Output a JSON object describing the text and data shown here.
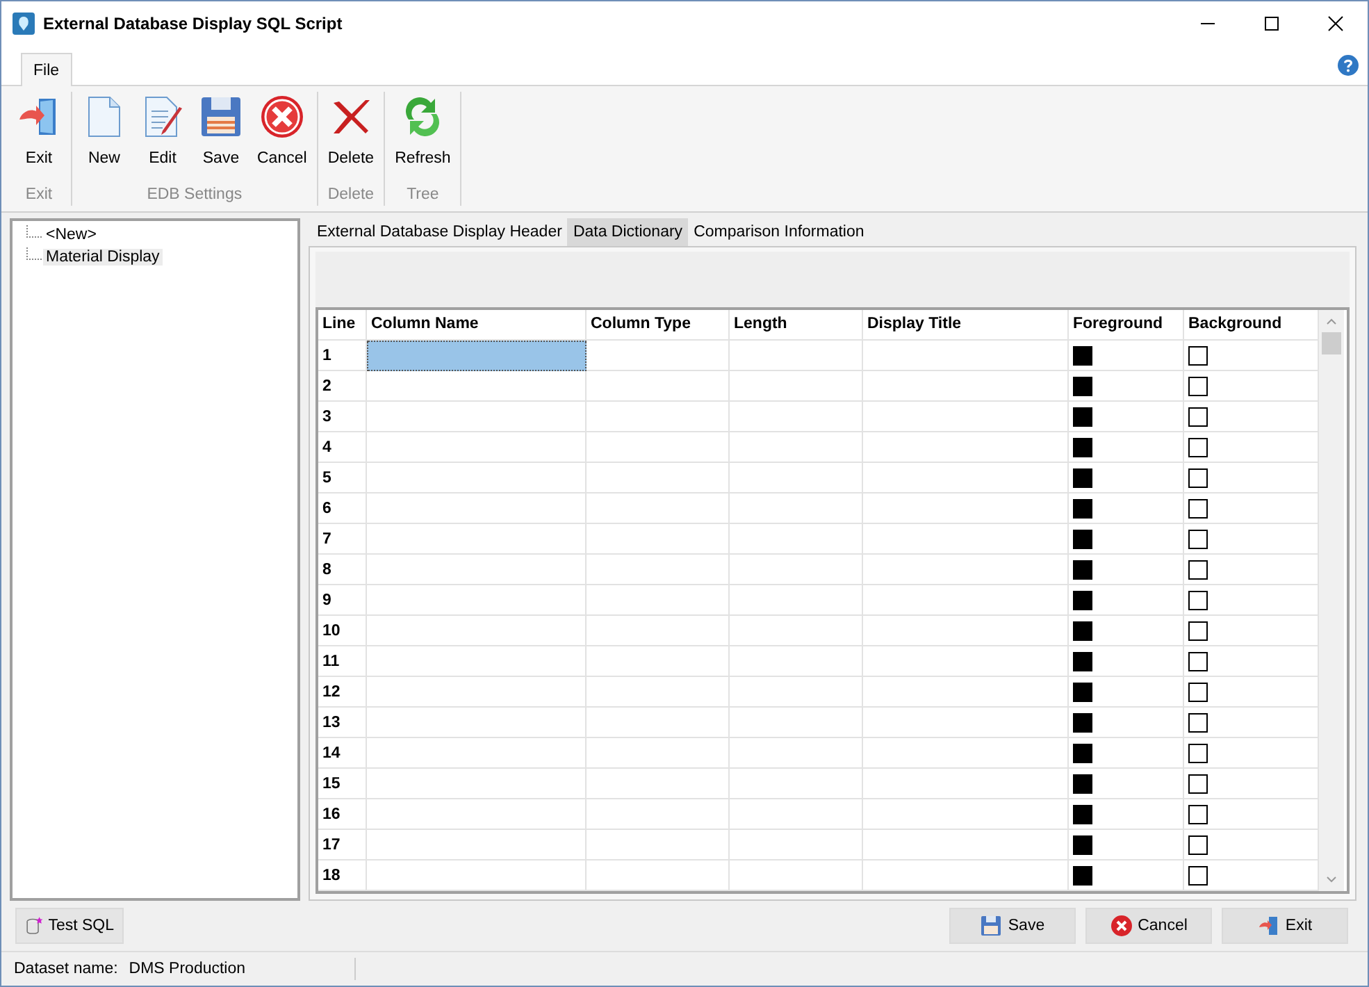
{
  "window": {
    "title": "External Database Display SQL Script"
  },
  "ribbon_tabs": [
    {
      "label": "File",
      "selected": true
    }
  ],
  "ribbon_groups": [
    {
      "label": "Exit",
      "buttons": [
        {
          "label": "Exit",
          "kind": "exit"
        }
      ]
    },
    {
      "label": "EDB Settings",
      "buttons": [
        {
          "label": "New",
          "kind": "new"
        },
        {
          "label": "Edit",
          "kind": "edit"
        },
        {
          "label": "Save",
          "kind": "save"
        },
        {
          "label": "Cancel",
          "kind": "cancel"
        }
      ]
    },
    {
      "label": "Delete",
      "buttons": [
        {
          "label": "Delete",
          "kind": "delete"
        }
      ]
    },
    {
      "label": "Tree",
      "buttons": [
        {
          "label": "Refresh",
          "kind": "refresh"
        }
      ]
    }
  ],
  "tree": [
    {
      "label": "<New>",
      "selected": false
    },
    {
      "label": "Material Display",
      "selected": true
    }
  ],
  "tabs": [
    {
      "label": "External Database Display Header",
      "selected": false
    },
    {
      "label": "Data Dictionary",
      "selected": true
    },
    {
      "label": "Comparison Information",
      "selected": false
    }
  ],
  "table": {
    "columns": [
      "Line",
      "Column Name",
      "Column Type",
      "Length",
      "Display Title",
      "Foreground",
      "Background"
    ],
    "rows": [
      {
        "line": "1",
        "selected": true
      },
      {
        "line": "2",
        "selected": false
      },
      {
        "line": "3",
        "selected": false
      },
      {
        "line": "4",
        "selected": false
      },
      {
        "line": "5",
        "selected": false
      },
      {
        "line": "6",
        "selected": false
      },
      {
        "line": "7",
        "selected": false
      },
      {
        "line": "8",
        "selected": false
      },
      {
        "line": "9",
        "selected": false
      },
      {
        "line": "10",
        "selected": false
      },
      {
        "line": "11",
        "selected": false
      },
      {
        "line": "12",
        "selected": false
      },
      {
        "line": "13",
        "selected": false
      },
      {
        "line": "14",
        "selected": false
      },
      {
        "line": "15",
        "selected": false
      },
      {
        "line": "16",
        "selected": false
      },
      {
        "line": "17",
        "selected": false
      },
      {
        "line": "18",
        "selected": false
      }
    ]
  },
  "footer_buttons": [
    {
      "label": "Save",
      "kind": "save"
    },
    {
      "label": "Cancel",
      "kind": "cancel"
    },
    {
      "label": "Exit",
      "kind": "exit"
    }
  ],
  "test_button": {
    "label": "Test SQL"
  },
  "status_bar": {
    "label": "Dataset name:",
    "value": "DMS Production"
  }
}
